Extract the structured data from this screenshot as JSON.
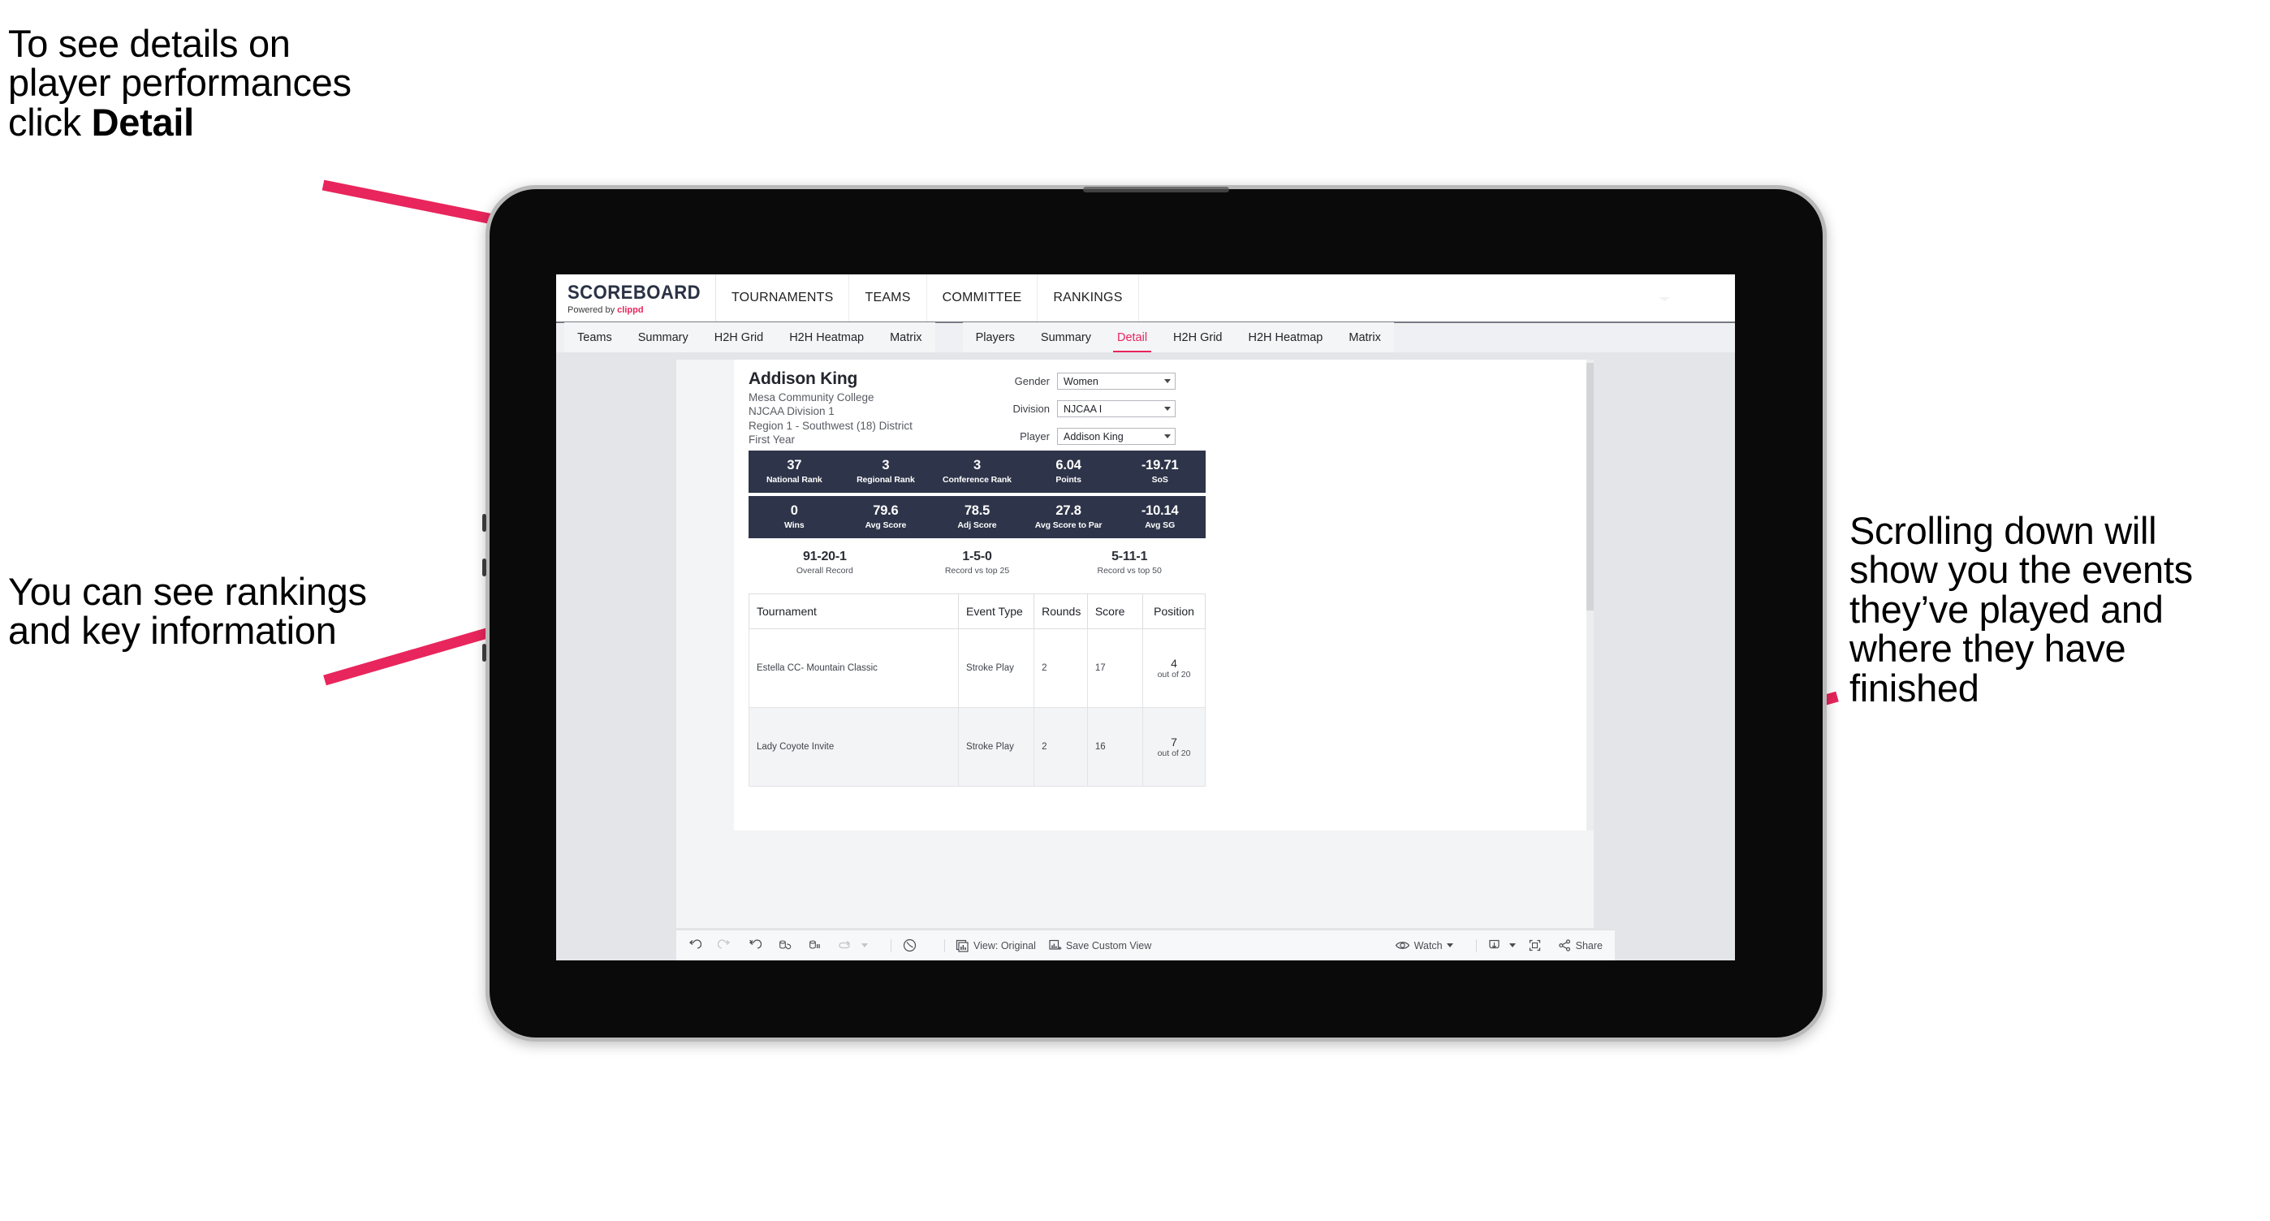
{
  "annotations": {
    "left_top_lines": [
      "To see details on",
      "player performances",
      "click "
    ],
    "left_top_bold": "Detail",
    "left_bottom": "You can see rankings and key information",
    "right": "Scrolling down will show you the events they’ve played and where they have finished"
  },
  "brand": {
    "title": "SCOREBOARD",
    "powered_prefix": "Powered by ",
    "powered_name": "clippd"
  },
  "topnav": [
    {
      "label": "TOURNAMENTS"
    },
    {
      "label": "TEAMS"
    },
    {
      "label": "COMMITTEE"
    },
    {
      "label": "RANKINGS"
    }
  ],
  "subtabs_teams": [
    {
      "label": "Teams",
      "active": false
    },
    {
      "label": "Summary",
      "active": false
    },
    {
      "label": "H2H Grid",
      "active": false
    },
    {
      "label": "H2H Heatmap",
      "active": false
    },
    {
      "label": "Matrix",
      "active": false
    }
  ],
  "subtabs_players": [
    {
      "label": "Players",
      "active": false
    },
    {
      "label": "Summary",
      "active": false
    },
    {
      "label": "Detail",
      "active": true
    },
    {
      "label": "H2H Grid",
      "active": false
    },
    {
      "label": "H2H Heatmap",
      "active": false
    },
    {
      "label": "Matrix",
      "active": false
    }
  ],
  "player": {
    "name": "Addison King",
    "school": "Mesa Community College",
    "division": "NJCAA Division 1",
    "region": "Region 1 - Southwest (18) District",
    "year": "First Year"
  },
  "selectors": [
    {
      "label": "Gender",
      "value": "Women"
    },
    {
      "label": "Division",
      "value": "NJCAA I"
    },
    {
      "label": "Player",
      "value": "Addison King"
    }
  ],
  "stats_row1": [
    {
      "value": "37",
      "label": "National Rank"
    },
    {
      "value": "3",
      "label": "Regional Rank"
    },
    {
      "value": "3",
      "label": "Conference Rank"
    },
    {
      "value": "6.04",
      "label": "Points"
    },
    {
      "value": "-19.71",
      "label": "SoS"
    }
  ],
  "stats_row2": [
    {
      "value": "0",
      "label": "Wins"
    },
    {
      "value": "79.6",
      "label": "Avg Score"
    },
    {
      "value": "78.5",
      "label": "Adj Score"
    },
    {
      "value": "27.8",
      "label": "Avg Score to Par"
    },
    {
      "value": "-10.14",
      "label": "Avg SG"
    }
  ],
  "records": [
    {
      "value": "91-20-1",
      "label": "Overall Record"
    },
    {
      "value": "1-5-0",
      "label": "Record vs top 25"
    },
    {
      "value": "5-11-1",
      "label": "Record vs top 50"
    }
  ],
  "table": {
    "headers": [
      "Tournament",
      "Event Type",
      "Rounds",
      "Score",
      "Position"
    ],
    "rows": [
      {
        "tournament": "Estella CC- Mountain Classic",
        "event_type": "Stroke Play",
        "rounds": "2",
        "score": "17",
        "position_num": "4",
        "position_of": "out of 20"
      },
      {
        "tournament": "Lady Coyote Invite",
        "event_type": "Stroke Play",
        "rounds": "2",
        "score": "16",
        "position_num": "7",
        "position_of": "out of 20"
      }
    ]
  },
  "toolbar": {
    "view_label": "View: Original",
    "save_label": "Save Custom View",
    "watch_label": "Watch",
    "share_label": "Share"
  },
  "colors": {
    "accent": "#e8255c",
    "band": "#2e3449",
    "brand_dark": "#2b3245"
  }
}
